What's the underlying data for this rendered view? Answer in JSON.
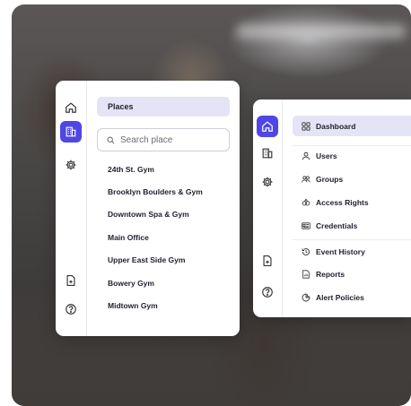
{
  "places_panel": {
    "header": "Places",
    "search_placeholder": "Search place",
    "places": [
      "24th St. Gym",
      "Brooklyn Boulders & Gym",
      "Downtown Spa & Gym",
      "Main Office",
      "Upper East Side Gym",
      "Bowery Gym",
      "Midtown Gym"
    ]
  },
  "menu_panel": {
    "items": [
      {
        "label": "Dashboard",
        "icon": "grid-icon",
        "active": true
      },
      {
        "label": "Users",
        "icon": "user-icon"
      },
      {
        "label": "Groups",
        "icon": "group-icon"
      },
      {
        "label": "Access Rights",
        "icon": "access-icon"
      },
      {
        "label": "Credentials",
        "icon": "credential-card-icon"
      },
      {
        "label": "Event History",
        "icon": "history-icon"
      },
      {
        "label": "Reports",
        "icon": "report-icon"
      },
      {
        "label": "Alert Policies",
        "icon": "alert-policy-icon"
      }
    ]
  },
  "rail_icons": [
    "home-icon",
    "building-icon",
    "gear-icon",
    "document-icon",
    "help-icon"
  ],
  "colors": {
    "accent": "#4f46e5",
    "active_bg": "#e4e4f6",
    "text": "#1f1f2e"
  }
}
